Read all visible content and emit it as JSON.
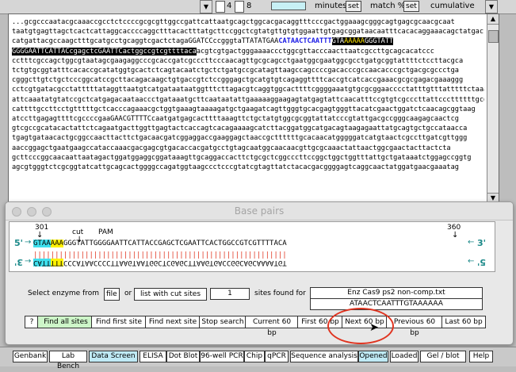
{
  "toolbar": {
    "box_value_1": "4",
    "box_value_2": "8",
    "minutes_label": "minutes",
    "set_label_1": "set",
    "match_label": "match %",
    "set_label_2": "set",
    "cumulative_label": "cumulative"
  },
  "sequence": {
    "line1": "...gcgcccaatacgcaaaccgcctctccccgcgcgttggccgattcattaatgcagctggcacgacaggtttcccgactggaaagcgggcagtgagcgcaacgcaat",
    "line2": "taatgtgagttagctcactcattaggcaccccaggctttacactttatgcttccggctcgtatgttgtgtggaattgtgagcggataacaatttcacacaggaaacagctatgac",
    "line3_a": "catgattacgccaagctttgcatgcctgcaggtcgactctagaGGATCCccgggtaTTATATGAA",
    "line3_b": "CATAACTCAATTT",
    "line3_c": "GTA",
    "line3_d": "AAAAA",
    "line3_e": "GGGTATT",
    "line4_a": "GGGGAATTCATTACcgagctcGAATTCactggccgtcgttttaca",
    "line4_b": "acgtcgtgactgggaaaaccctggcgttacccaacttaatcgccttgcagcacatccc",
    "line5": "cctttcgccagctggcgtaatagcgaagaggcccgcaccgatcgcccttcccaacagttgcgcagcctgaatggcgaatggcgcctgatgcggtattttctccttacgca",
    "line6": "tctgtgcggtatttcacaccgcatatggtgcactctcagtacaatctgctctgatgccgcatagttaagccagccccgacacccgccaacacccgctgacgcgccctga",
    "line7": "cgggcttgtctgctcccggcatccgcttacagacaagctgtgaccgtctccgggagctgcatgtgtcagaggttttcaccgtcatcaccgaaacgcgcgagacgaaaggg",
    "line8": "cctcgtgatacgcctatttttataggttaatgtcatgataataatggtttcttagacgtcaggtggcacttttcggggaaatgtgcgcggaacccctatttgtttatttttctaaatac",
    "line9": "attcaaatatgtatccgctcatgagacaataaccctgataaatgcttcaataatattgaaaaaggaagagtatgagtattcaacatttccgtgtcgcccttattcccttttttgcgg",
    "line10": "cattttgccttcctgtttttgctcacccagaaacgctggtgaaagtaaaagatgctgaagatcagttgggtgcacgagtgggttacatcgaactggatctcaacagcggtaag",
    "line11": "atccttgagagttttcgccccgaaGAACGTTTTCcaatgatgagcacttttaaagttctgctatgtggcgcggtattatcccgtattgacgccgggcaagagcaactcg",
    "line12": "gtcgccgcatacactattctcagaatgacttggttgagtactcaccagtcacagaaaagcatcttacggatggcatgacagtaagagaattatgcagtgctgccataacca",
    "line13": "tgagtgataacactgcggccaacttacttctgacaacgatcggaggaccgaaggagctaaccgcttttttgcacaacatgggggatcatgtaactcgccttgatcgttggg",
    "line14": "aaccggagctgaatgaagccataccaaacgacgagcgtgacaccacgatgcctgtagcaatggcaacaacgttgcgcaaactattaactggcgaactacttactcta",
    "line15": "gcttcccggcaacaattaatagactggatggaggcggataaagttgcaggaccacttctgcgctcggcccttccggctggctggtttattgctgataaatctggagccggtg",
    "line16": "agcgtgggtctcgcggtatcattgcagcactggggccagatggtaagccctcccgtatcgtagttatctacacgacggggagtcaggcaactatggatgaacgaaatag"
  },
  "base_pairs": {
    "title": "Base pairs",
    "pos_start": "301",
    "cut_label": "cut",
    "pam_label": "PAM",
    "pos_end": "360",
    "five_prime": "5'",
    "three_prime": "3'",
    "top_cyan": "GTAA",
    "top_yellow": "AAA",
    "top_rest": "GGGTATTGGGGAATTCATTACCGAGCTCGAATTCACTGGCCGTCGTTTTACA",
    "bottom_cyan": "CATT",
    "bottom_yellow": "TTT",
    "bottom_rest": "CCCATAACCCCTTAAGTAATGGCTCGAGCTTAAGTGACCGGCAGCAAAATGT",
    "ticks": "|||||||||||||||||||||||||||||||||||||||||||||||||||||||||||"
  },
  "controls": {
    "select_enzyme_label": "Select enzyme from",
    "file_label": "file",
    "or_label": "or",
    "list_label": "list with cut sites",
    "count_value": "1",
    "sites_found_label": "sites found for",
    "enzyme_file": "Enz Cas9 ps2 non-comp.txt",
    "enzyme_seq": "ATAACTCAATTTGTAAAAAA",
    "help_label": "?",
    "find_all": "Find all sites",
    "find_first": "Find first site",
    "find_next": "Find next site",
    "stop_search": "Stop search",
    "current_60": "Current 60 bp",
    "first_60": "First 60 bp",
    "next_60": "Next 60 bp",
    "previous_60": "Previous 60 bp",
    "last_60": "Last 60 bp"
  },
  "nav": {
    "genbank": "Genbank",
    "lab_bench": "Lab Bench",
    "data_screen": "Data Screen",
    "elisa": "ELISA",
    "dot_blot": "Dot Blot",
    "well_pcr": "96-well PCR",
    "chip": "Chip",
    "qpcr": "qPCR",
    "sequence_analysis": "Sequence analysis",
    "opened": "Opened",
    "loaded": "Loaded",
    "gel_blot": "Gel / blot",
    "help": "Help"
  }
}
